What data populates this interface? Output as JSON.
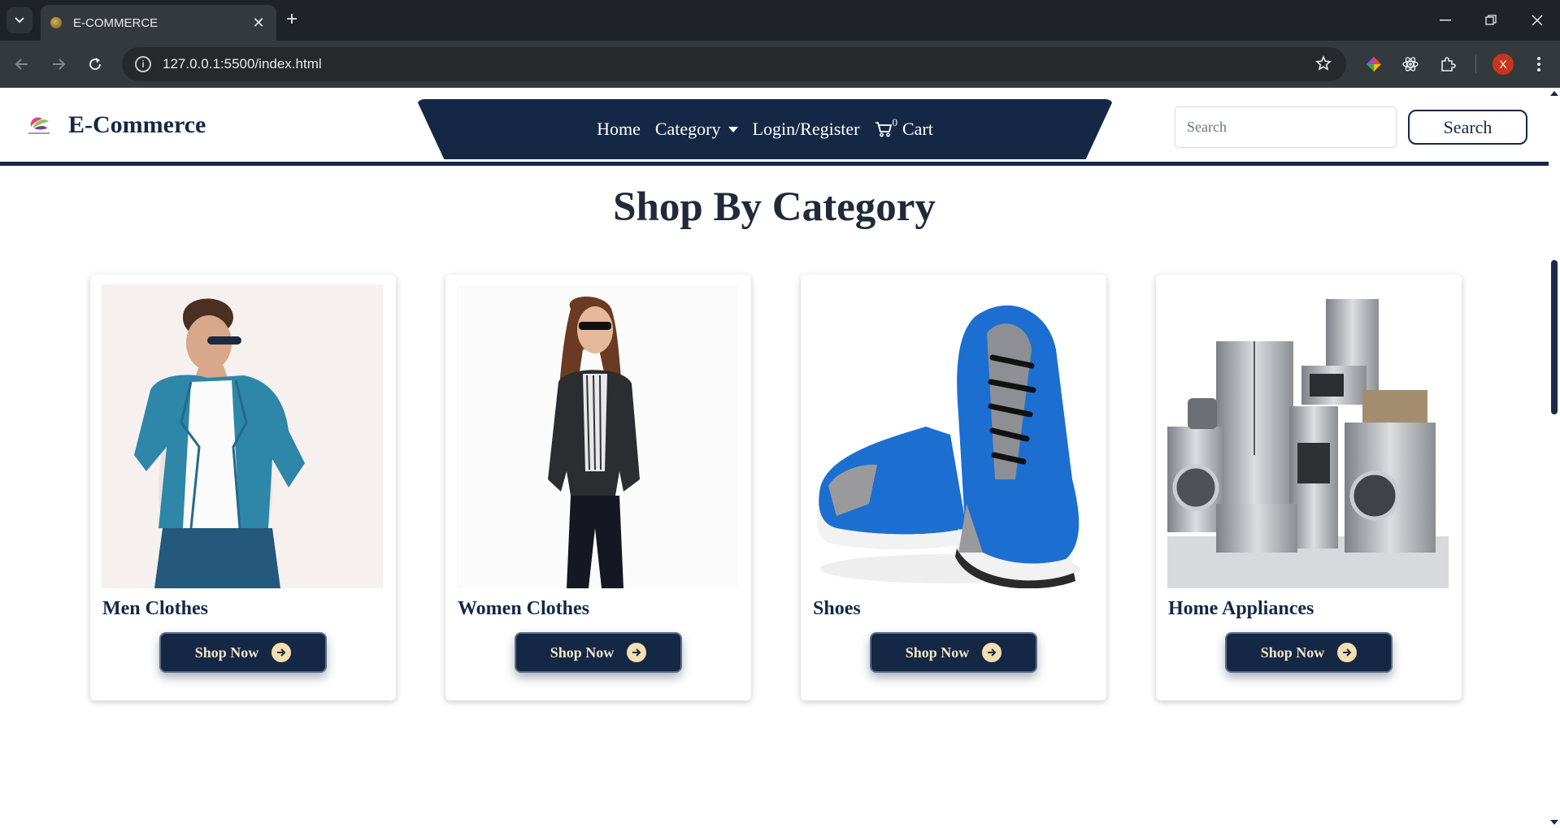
{
  "browser": {
    "tab_title": "E-COMMERCE",
    "url": "127.0.0.1:5500/index.html",
    "profile_initial": "X"
  },
  "navbar": {
    "brand_name": "E-Commerce",
    "menu": {
      "home": "Home",
      "category": "Category",
      "login": "Login/Register",
      "cart_count": "0",
      "cart": "Cart"
    },
    "search_placeholder": "Search",
    "search_button": "Search"
  },
  "main": {
    "section_title": "Shop By Category",
    "categories": [
      {
        "title": "Men Clothes",
        "button": "Shop Now"
      },
      {
        "title": "Women Clothes",
        "button": "Shop Now"
      },
      {
        "title": "Shoes",
        "button": "Shop Now"
      },
      {
        "title": "Home Appliances",
        "button": "Shop Now"
      }
    ]
  },
  "colors": {
    "brand_navy": "#142846",
    "button_text": "#f3e4c6",
    "arrow_badge": "#f5deb0"
  }
}
